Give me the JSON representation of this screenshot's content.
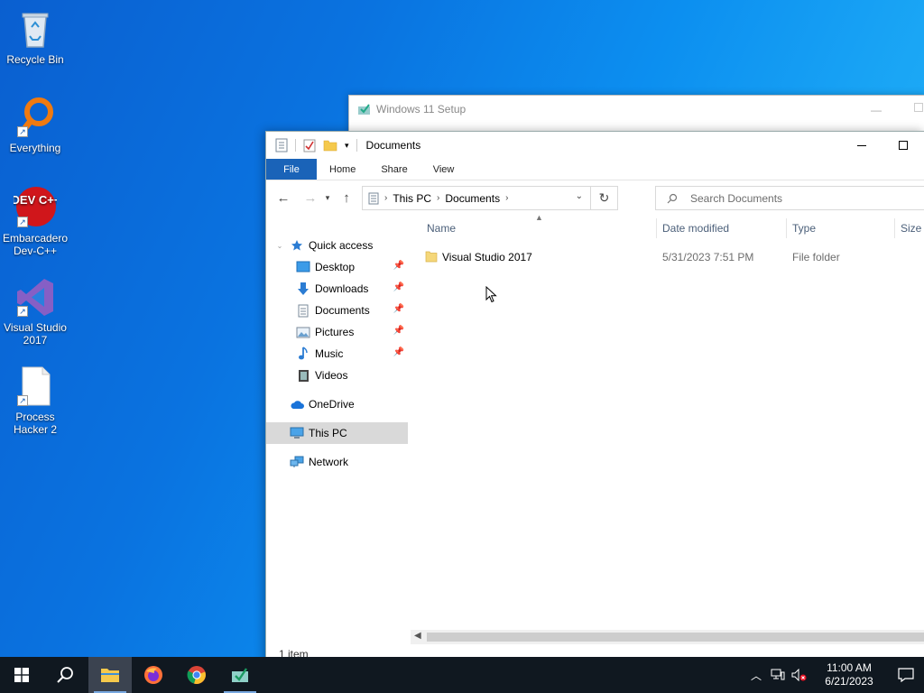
{
  "desktop": {
    "icons": [
      {
        "label": "Recycle Bin"
      },
      {
        "label": "Everything"
      },
      {
        "label": "Embarcadero Dev-C++",
        "logo_text": "DEV C++"
      },
      {
        "label": "Visual Studio 2017"
      },
      {
        "label": "Process Hacker 2"
      }
    ]
  },
  "setup_window": {
    "title": "Windows 11 Setup"
  },
  "explorer": {
    "title": "Documents",
    "ribbon_tabs": [
      "File",
      "Home",
      "Share",
      "View"
    ],
    "address": {
      "crumbs": [
        "This PC",
        "Documents"
      ]
    },
    "search": {
      "placeholder": "Search Documents"
    },
    "nav": {
      "quick_access": "Quick access",
      "items": [
        {
          "label": "Desktop",
          "pinned": true
        },
        {
          "label": "Downloads",
          "pinned": true
        },
        {
          "label": "Documents",
          "pinned": true
        },
        {
          "label": "Pictures",
          "pinned": true
        },
        {
          "label": "Music",
          "pinned": true
        },
        {
          "label": "Videos",
          "pinned": false
        }
      ],
      "onedrive": "OneDrive",
      "this_pc": "This PC",
      "network": "Network"
    },
    "columns": {
      "name": "Name",
      "date": "Date modified",
      "type": "Type",
      "size": "Size"
    },
    "files": [
      {
        "name": "Visual Studio 2017",
        "date": "5/31/2023 7:51 PM",
        "type": "File folder"
      }
    ],
    "status": "1 item"
  },
  "taskbar": {
    "time": "11:00 AM",
    "date": "6/21/2023"
  },
  "colors": {
    "ribbon_file": "#1a63b8",
    "taskbar": "#101820",
    "folder": "#f5c94c"
  }
}
